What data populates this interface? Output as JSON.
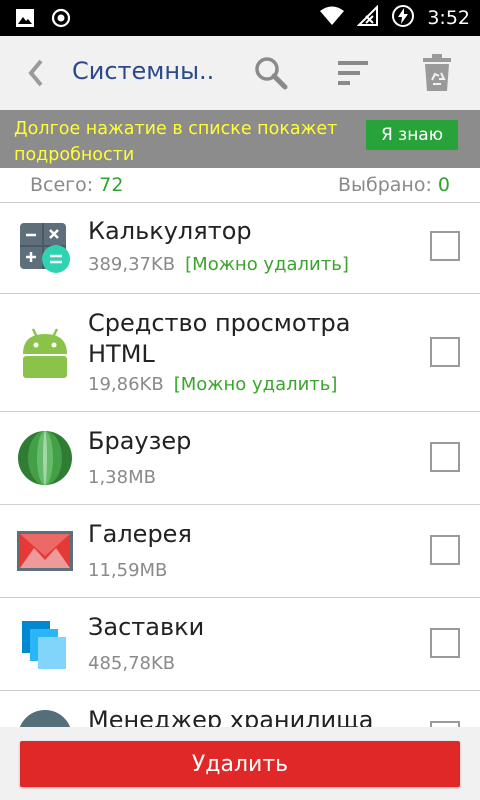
{
  "status_bar": {
    "time": "3:52",
    "icons": [
      "image-icon",
      "record-icon",
      "wifi-icon",
      "no-signal-icon",
      "battery-charging-icon"
    ]
  },
  "appbar": {
    "title": "Системны..",
    "icons": [
      "back-icon",
      "search-icon",
      "sort-icon",
      "recycle-bin-icon"
    ]
  },
  "hint": {
    "text": "Долгое нажатие в списке покажет подробности",
    "button": "Я знаю"
  },
  "summary": {
    "total_label": "Всего:",
    "total_value": "72",
    "selected_label": "Выбрано:",
    "selected_value": "0"
  },
  "apps": [
    {
      "name": "Калькулятор",
      "size": "389,37KB",
      "tag": "[Можно удалить]",
      "icon": "calculator-icon",
      "checked": false
    },
    {
      "name": "Средство просмотра HTML",
      "size": "19,86KB",
      "tag": "[Можно удалить]",
      "icon": "android-icon",
      "checked": false
    },
    {
      "name": "Браузер",
      "size": "1,38MB",
      "tag": "",
      "icon": "browser-icon",
      "checked": false
    },
    {
      "name": "Галерея",
      "size": "11,59MB",
      "tag": "",
      "icon": "gallery-icon",
      "checked": false
    },
    {
      "name": "Заставки",
      "size": "485,78KB",
      "tag": "",
      "icon": "screensaver-icon",
      "checked": false
    },
    {
      "name": "Менеджер хранилища",
      "size": "",
      "tag": "",
      "icon": "storage-manager-icon",
      "checked": false
    }
  ],
  "footer": {
    "delete_label": "Удалить"
  },
  "colors": {
    "title": "#2c4a8a",
    "hint_text": "#ffff33",
    "hint_button": "#27a33a",
    "accent_green": "#2fa52f",
    "delete": "#e12828"
  }
}
